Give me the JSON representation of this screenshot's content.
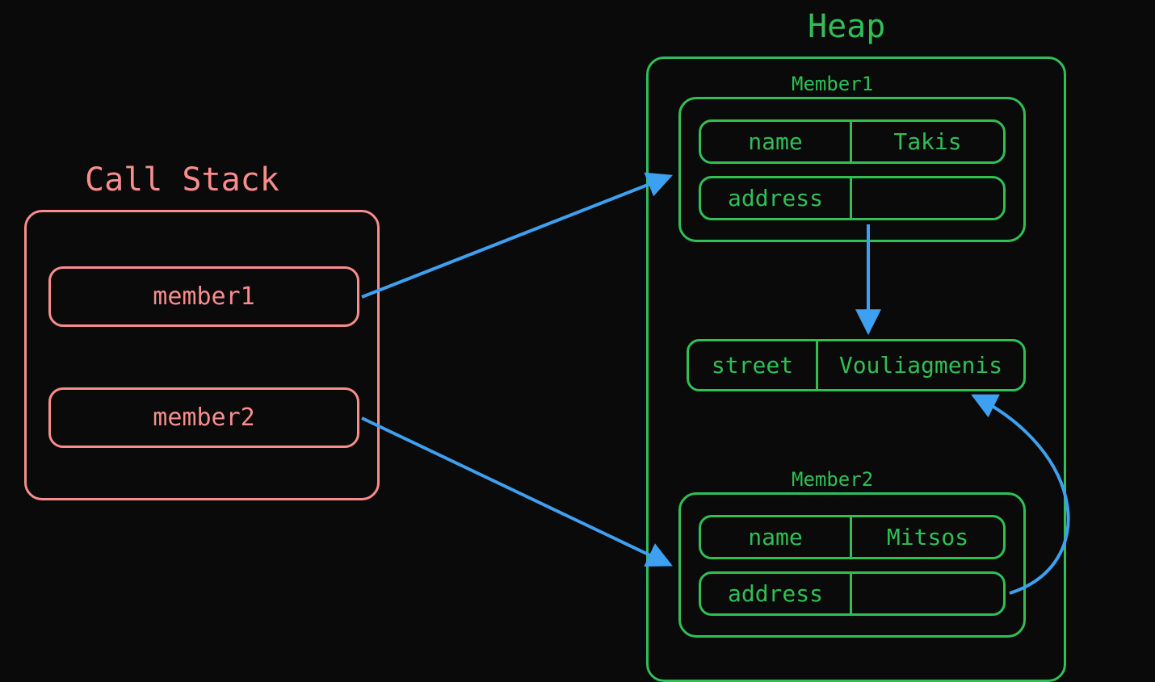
{
  "callStack": {
    "title": "Call Stack",
    "vars": [
      "member1",
      "member2"
    ]
  },
  "heap": {
    "title": "Heap",
    "member1": {
      "label": "Member1",
      "name_key": "name",
      "name_value": "Takis",
      "address_key": "address",
      "address_value": ""
    },
    "street": {
      "key": "street",
      "value": "Vouliagmenis"
    },
    "member2": {
      "label": "Member2",
      "name_key": "name",
      "name_value": "Mitsos",
      "address_key": "address",
      "address_value": ""
    }
  },
  "colors": {
    "stack": "#f98c8c",
    "heap": "#2fbf56",
    "arrow": "#3ea0f0",
    "bg": "#0a0a0a"
  }
}
